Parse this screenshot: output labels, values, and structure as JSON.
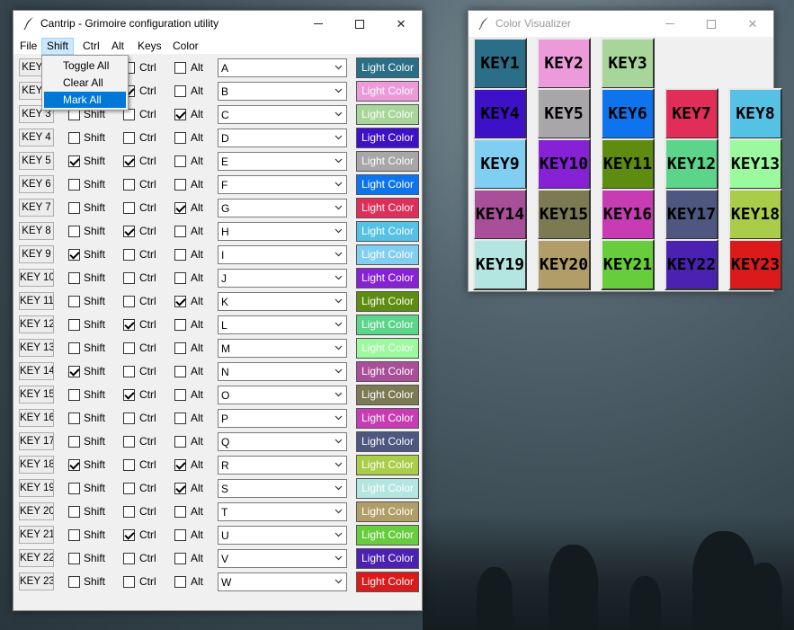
{
  "main_window": {
    "title": "Cantrip - Grimoire configuration utility",
    "menus": [
      "File",
      "Shift",
      "Ctrl",
      "Alt",
      "Keys",
      "Color"
    ],
    "open_menu": "Shift",
    "dropdown_items": [
      "Toggle All",
      "Clear All",
      "Mark All"
    ],
    "dropdown_active": "Mark All",
    "modifier_labels": {
      "shift": "Shift",
      "ctrl": "Ctrl",
      "alt": "Alt"
    },
    "rows": [
      {
        "key": "KEY 1",
        "shift": false,
        "ctrl": false,
        "alt": false,
        "value": "A",
        "color_label": "Light Color",
        "color": "#2b6e87"
      },
      {
        "key": "KEY 2",
        "shift": false,
        "ctrl": true,
        "alt": false,
        "value": "B",
        "color_label": "Light Color",
        "color": "#ed9ada"
      },
      {
        "key": "KEY 3",
        "shift": false,
        "ctrl": false,
        "alt": true,
        "value": "C",
        "color_label": "Light Color",
        "color": "#a8d69a"
      },
      {
        "key": "KEY 4",
        "shift": false,
        "ctrl": false,
        "alt": false,
        "value": "D",
        "color_label": "Light Color",
        "color": "#3c11c8"
      },
      {
        "key": "KEY 5",
        "shift": true,
        "ctrl": true,
        "alt": false,
        "value": "E",
        "color_label": "Light Color",
        "color": "#a8a6a8"
      },
      {
        "key": "KEY 6",
        "shift": false,
        "ctrl": false,
        "alt": false,
        "value": "F",
        "color_label": "Light Color",
        "color": "#0d74ee"
      },
      {
        "key": "KEY 7",
        "shift": false,
        "ctrl": false,
        "alt": true,
        "value": "G",
        "color_label": "Light Color",
        "color": "#e02e58"
      },
      {
        "key": "KEY 8",
        "shift": false,
        "ctrl": true,
        "alt": false,
        "value": "H",
        "color_label": "Light Color",
        "color": "#55c1e4"
      },
      {
        "key": "KEY 9",
        "shift": true,
        "ctrl": false,
        "alt": false,
        "value": "I",
        "color_label": "Light Color",
        "color": "#80cef2"
      },
      {
        "key": "KEY 10",
        "shift": false,
        "ctrl": false,
        "alt": false,
        "value": "J",
        "color_label": "Light Color",
        "color": "#8621d6"
      },
      {
        "key": "KEY 11",
        "shift": false,
        "ctrl": false,
        "alt": true,
        "value": "K",
        "color_label": "Light Color",
        "color": "#5e8c10"
      },
      {
        "key": "KEY 12",
        "shift": false,
        "ctrl": true,
        "alt": false,
        "value": "L",
        "color_label": "Light Color",
        "color": "#5cd58a"
      },
      {
        "key": "KEY 13",
        "shift": false,
        "ctrl": false,
        "alt": false,
        "value": "M",
        "color_label": "Light Color",
        "color": "#9bfa9d"
      },
      {
        "key": "KEY 14",
        "shift": true,
        "ctrl": false,
        "alt": false,
        "value": "N",
        "color_label": "Light Color",
        "color": "#a94f9a"
      },
      {
        "key": "KEY 15",
        "shift": false,
        "ctrl": true,
        "alt": false,
        "value": "O",
        "color_label": "Light Color",
        "color": "#7b7a53"
      },
      {
        "key": "KEY 16",
        "shift": false,
        "ctrl": false,
        "alt": false,
        "value": "P",
        "color_label": "Light Color",
        "color": "#c83cb3"
      },
      {
        "key": "KEY 17",
        "shift": false,
        "ctrl": false,
        "alt": false,
        "value": "Q",
        "color_label": "Light Color",
        "color": "#4d577f"
      },
      {
        "key": "KEY 18",
        "shift": true,
        "ctrl": false,
        "alt": true,
        "value": "R",
        "color_label": "Light Color",
        "color": "#a9cc49"
      },
      {
        "key": "KEY 19",
        "shift": false,
        "ctrl": false,
        "alt": true,
        "value": "S",
        "color_label": "Light Color",
        "color": "#b3e6e0"
      },
      {
        "key": "KEY 20",
        "shift": false,
        "ctrl": false,
        "alt": false,
        "value": "T",
        "color_label": "Light Color",
        "color": "#b09d67"
      },
      {
        "key": "KEY 21",
        "shift": false,
        "ctrl": true,
        "alt": false,
        "value": "U",
        "color_label": "Light Color",
        "color": "#67cd3c"
      },
      {
        "key": "KEY 22",
        "shift": false,
        "ctrl": false,
        "alt": false,
        "value": "V",
        "color_label": "Light Color",
        "color": "#4a21b0"
      },
      {
        "key": "KEY 23",
        "shift": false,
        "ctrl": false,
        "alt": false,
        "value": "W",
        "color_label": "Light Color",
        "color": "#db1b1b"
      }
    ]
  },
  "visualizer_window": {
    "title": "Color Visualizer",
    "tiles": [
      {
        "label": "KEY1",
        "color": "#2b6e87"
      },
      {
        "label": "KEY2",
        "color": "#ed9ada"
      },
      {
        "label": "KEY3",
        "color": "#a8d69a"
      },
      {
        "label": "KEY4",
        "color": "#3c11c8"
      },
      {
        "label": "KEY5",
        "color": "#a8a6a8"
      },
      {
        "label": "KEY6",
        "color": "#0d74ee"
      },
      {
        "label": "KEY7",
        "color": "#e02e58"
      },
      {
        "label": "KEY8",
        "color": "#55c1e4"
      },
      {
        "label": "KEY9",
        "color": "#80cef2"
      },
      {
        "label": "KEY10",
        "color": "#8621d6"
      },
      {
        "label": "KEY11",
        "color": "#5e8c10"
      },
      {
        "label": "KEY12",
        "color": "#5cd58a"
      },
      {
        "label": "KEY13",
        "color": "#9bfa9d"
      },
      {
        "label": "KEY14",
        "color": "#a94f9a"
      },
      {
        "label": "KEY15",
        "color": "#7b7a53"
      },
      {
        "label": "KEY16",
        "color": "#c83cb3"
      },
      {
        "label": "KEY17",
        "color": "#4d577f"
      },
      {
        "label": "KEY18",
        "color": "#a9cc49"
      },
      {
        "label": "KEY19",
        "color": "#b3e6e0"
      },
      {
        "label": "KEY20",
        "color": "#b09d67"
      },
      {
        "label": "KEY21",
        "color": "#67cd3c"
      },
      {
        "label": "KEY22",
        "color": "#4a21b0"
      },
      {
        "label": "KEY23",
        "color": "#db1b1b"
      }
    ]
  }
}
